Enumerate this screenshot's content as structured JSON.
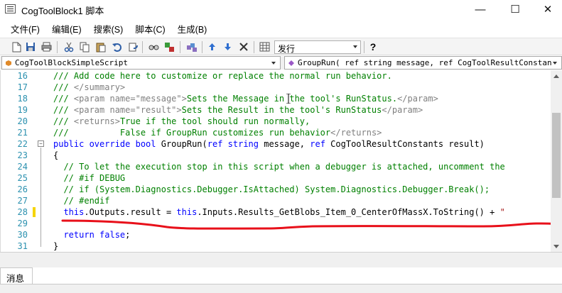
{
  "window": {
    "title": "CogToolBlock1 脚本",
    "minimize_glyph": "—",
    "maximize_glyph": "☐",
    "close_glyph": "✕"
  },
  "menu": [
    "文件(F)",
    "编辑(E)",
    "搜索(S)",
    "脚本(C)",
    "生成(B)"
  ],
  "toolbar": {
    "icons": [
      "new-icon",
      "save-icon",
      "print-icon",
      "cut-icon",
      "copy-icon",
      "paste-icon",
      "undo-icon",
      "redo-icon",
      "find-icon",
      "replace-icon",
      "build-icon",
      "up-arrow-icon",
      "down-arrow-icon",
      "delete-icon",
      "calculator-icon",
      "help-icon"
    ],
    "config_value": "发行",
    "help_glyph": "?"
  },
  "selectors": {
    "class_value": "CogToolBlockSimpleScript",
    "member_value": "GroupRun( ref string message,  ref CogToolResultConstan"
  },
  "editor": {
    "lines": [
      {
        "n": "16",
        "parts": [
          [
            "com",
            "/// Add code here to customize or replace the normal run behavior."
          ]
        ]
      },
      {
        "n": "17",
        "parts": [
          [
            "com",
            "/// "
          ],
          [
            "tag",
            "</summary>"
          ]
        ]
      },
      {
        "n": "18",
        "parts": [
          [
            "com",
            "/// "
          ],
          [
            "tag",
            "<param name=\"message\">"
          ],
          [
            "com",
            "Sets the Message in the tool's RunStatus."
          ],
          [
            "tag",
            "</param>"
          ]
        ]
      },
      {
        "n": "19",
        "parts": [
          [
            "com",
            "/// "
          ],
          [
            "tag",
            "<param name=\"result\">"
          ],
          [
            "com",
            "Sets the Result in the tool's RunStatus"
          ],
          [
            "tag",
            "</param>"
          ]
        ]
      },
      {
        "n": "20",
        "parts": [
          [
            "com",
            "/// "
          ],
          [
            "tag",
            "<returns>"
          ],
          [
            "com",
            "True if the tool should run normally,"
          ]
        ]
      },
      {
        "n": "21",
        "parts": [
          [
            "com",
            "///          False if GroupRun customizes run behavior"
          ],
          [
            "tag",
            "</returns>"
          ]
        ]
      },
      {
        "n": "22",
        "parts": [
          [
            "kw",
            "public override bool "
          ],
          [
            "txt",
            "GroupRun("
          ],
          [
            "kw",
            "ref string "
          ],
          [
            "txt",
            "message, "
          ],
          [
            "kw",
            "ref "
          ],
          [
            "txt",
            "CogToolResultConstants result)"
          ]
        ]
      },
      {
        "n": "23",
        "parts": [
          [
            "txt",
            "{"
          ]
        ]
      },
      {
        "n": "24",
        "parts": [
          [
            "com",
            "  // To let the execution stop in this script when a debugger is attached, uncomment the"
          ]
        ]
      },
      {
        "n": "25",
        "parts": [
          [
            "com",
            "  // #if DEBUG"
          ]
        ]
      },
      {
        "n": "26",
        "parts": [
          [
            "com",
            "  // if (System.Diagnostics.Debugger.IsAttached) System.Diagnostics.Debugger.Break();"
          ]
        ]
      },
      {
        "n": "27",
        "parts": [
          [
            "com",
            "  // #endif"
          ]
        ]
      },
      {
        "n": "28",
        "parts": [
          [
            "kw",
            "  this"
          ],
          [
            "txt",
            ".Outputs.result = "
          ],
          [
            "kw",
            "this"
          ],
          [
            "txt",
            ".Inputs.Results_GetBlobs_Item_0_CenterOfMassX.ToString() + "
          ],
          [
            "red",
            "\""
          ]
        ]
      },
      {
        "n": "29",
        "parts": []
      },
      {
        "n": "30",
        "parts": [
          [
            "kw",
            "  return false"
          ],
          [
            "txt",
            ";"
          ]
        ]
      },
      {
        "n": "31",
        "parts": [
          [
            "txt",
            "}"
          ]
        ]
      }
    ]
  },
  "bottom": {
    "tab_label": "消息"
  }
}
